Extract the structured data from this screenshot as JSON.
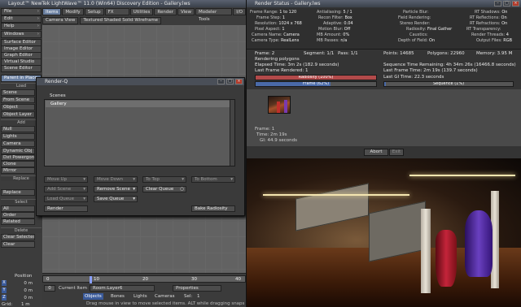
{
  "lightwave": {
    "title": "Layout™ NewTek LightWave™ 11.0 (Win64) Discovery Edition - Gallery.lws",
    "tabs": [
      "Items",
      "Modify",
      "Setup",
      "FX Tools",
      "Utilities",
      "Render",
      "View",
      "Modeler Tools",
      "I/O"
    ],
    "menu": [
      "File",
      "Edit",
      "Help",
      "Windows",
      "Surface Editor",
      "Image Editor",
      "Graph Editor",
      "Virtual Studio",
      "Scene Editor"
    ],
    "parent_in_place": "Parent in Place",
    "load_header": "Load",
    "load_items": [
      "Scene",
      "From Scene",
      "Object",
      "Object Layer"
    ],
    "add_header": "Add",
    "add_items": [
      "Null",
      "Lights",
      "Camera",
      "Dynamic Obj",
      "Dxt Powergons",
      "Clone",
      "Mirror"
    ],
    "replace_header": "Replace",
    "replace_items": [
      "Replace"
    ],
    "select_header": "Select",
    "select_items": [
      "All",
      "Order",
      "Related"
    ],
    "delete_header": "Delete",
    "delete_items": [
      "Clear Selected",
      "Clear"
    ],
    "viewbar": {
      "view": "Camera View",
      "mode": "Textured Shaded Solid Wireframe"
    },
    "timeline": {
      "ticks": [
        "0",
        "10",
        "20",
        "30",
        "40"
      ],
      "frame_field": "0"
    },
    "position_label": "Position",
    "coords": [
      {
        "axis": "X",
        "value": "0 m"
      },
      {
        "axis": "Y",
        "value": "0 m"
      },
      {
        "axis": "Z",
        "value": "0 m"
      }
    ],
    "grid_label": "Grid:",
    "grid_value": "1 m",
    "current_item_label": "Current Item",
    "current_item_value": "Room:Layer6",
    "properties_button": "Properties",
    "sel_row": {
      "objects": "Objects",
      "bones": "Bones",
      "lights": "Lights",
      "cameras": "Cameras",
      "sel_label": "Sel:",
      "sel_value": "1"
    },
    "status_text": "Drag mouse in view to move selected items. ALT while dragging snaps to the"
  },
  "render_q": {
    "title": "Render-Q",
    "list_header": "Scenes",
    "scenes": [
      "Gallery"
    ],
    "buttons": {
      "move_up": "Move Up",
      "move_down": "Move Down",
      "to_top": "To Top",
      "to_bottom": "To Bottom",
      "add_scene": "Add Scene",
      "remove_scene": "Remove Scene",
      "clear_queue": "Clear Queue",
      "load_queue": "Load Queue",
      "save_queue": "Save Queue",
      "render": "Render",
      "bake_radiosity": "Bake Radiosity"
    }
  },
  "render_status": {
    "title": "Render Status - Gallery.lws",
    "stats_col1": [
      {
        "k": "Frame Range:",
        "v": "1 to 120"
      },
      {
        "k": "Frame Step:",
        "v": "1"
      },
      {
        "k": "Resolution:",
        "v": "1024 x 768"
      },
      {
        "k": "Pixel Aspect:",
        "v": "1"
      },
      {
        "k": "Camera Name:",
        "v": "Camera"
      },
      {
        "k": "Camera Type:",
        "v": "RealLens"
      }
    ],
    "stats_col2": [
      {
        "k": "Antialiasing:",
        "v": "5 / 1"
      },
      {
        "k": "Recon Filter:",
        "v": "Box"
      },
      {
        "k": "Adaptive:",
        "v": "0.04"
      },
      {
        "k": "Motion Blur:",
        "v": "Off"
      },
      {
        "k": "MB Amount:",
        "v": "0%"
      },
      {
        "k": "MB Passes:",
        "v": "n/a"
      }
    ],
    "stats_col3": [
      {
        "k": "Particle Blur:",
        "v": ""
      },
      {
        "k": "Field Rendering:",
        "v": ""
      },
      {
        "k": "Stereo Render:",
        "v": ""
      },
      {
        "k": "Radiosity:",
        "v": "Final Gather"
      },
      {
        "k": "Caustics:",
        "v": ""
      },
      {
        "k": "Depth of Field:",
        "v": "On"
      }
    ],
    "stats_col4": [
      {
        "k": "RT Shadows:",
        "v": "On"
      },
      {
        "k": "RT Reflections:",
        "v": "On"
      },
      {
        "k": "RT Refractions:",
        "v": "On"
      },
      {
        "k": "RT Transparency:",
        "v": ""
      },
      {
        "k": "Render Threads:",
        "v": "4"
      },
      {
        "k": "Output Files:",
        "v": "RGB"
      }
    ],
    "progress": {
      "frame": "Frame: 2",
      "segment": "Segment: 1/1",
      "pass": "Pass: 1/1",
      "points": "Points: 14685",
      "polygons": "Polygons: 22960",
      "memory": "Memory: 3.95 M",
      "phase": "Rendering polygons",
      "elapsed": "Elapsed Time: 3m 2s (182.9 seconds)",
      "last_frame": "Last Frame Rendered: 1",
      "seq_remaining": "Sequence Time Remaining: 4h 34m 26s (16466.8 seconds)",
      "last_frame_time": "Last Frame Time: 2m 19s (139.7 seconds)",
      "last_gi": "Last GI Time: 22.3 seconds",
      "radiosity_bar": "Radiosity (100%)",
      "radiosity_frac": 1.0,
      "frame_bar": "Frame (62%)",
      "frame_frac": 0.62,
      "sequence_bar": "Sequence (1%)",
      "sequence_frac": 0.01
    },
    "thumb_info": [
      "Frame: 1",
      "Time: 2m 19s",
      "GI: 44.9 seconds"
    ],
    "abort": "Abort",
    "exit": "Exit"
  }
}
